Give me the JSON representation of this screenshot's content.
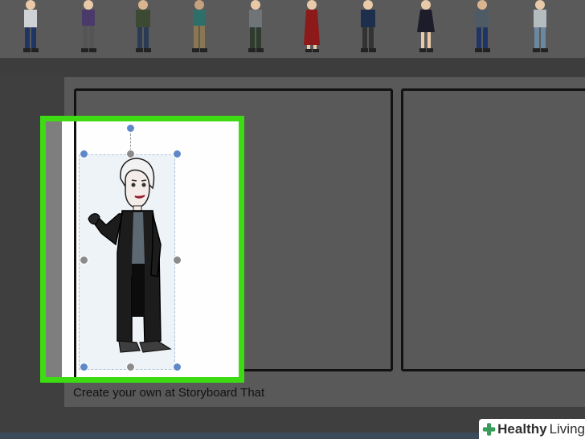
{
  "palette": {
    "characters": [
      {
        "name": "Male character in blue jeans"
      },
      {
        "name": "Female character in purple top"
      },
      {
        "name": "Male character in military jacket"
      },
      {
        "name": "Female character in teal shirt"
      },
      {
        "name": "Male character in gray shirt"
      },
      {
        "name": "Female character in red dress"
      },
      {
        "name": "Male character in navy jacket"
      },
      {
        "name": "Female character in dark dress"
      },
      {
        "name": "Male character in plaid shirt"
      },
      {
        "name": "Male character in white shirt"
      }
    ]
  },
  "storyboard": {
    "footer": "Create your own at Storyboard That"
  },
  "selection": {
    "character": "Vampire character in long black coat"
  },
  "watermark": {
    "brand": "Healthy",
    "rest": "Living"
  },
  "colors": {
    "highlight": "#3cdb12",
    "handle_blue": "#5f88c9",
    "handle_gray": "#8b8b8b"
  }
}
